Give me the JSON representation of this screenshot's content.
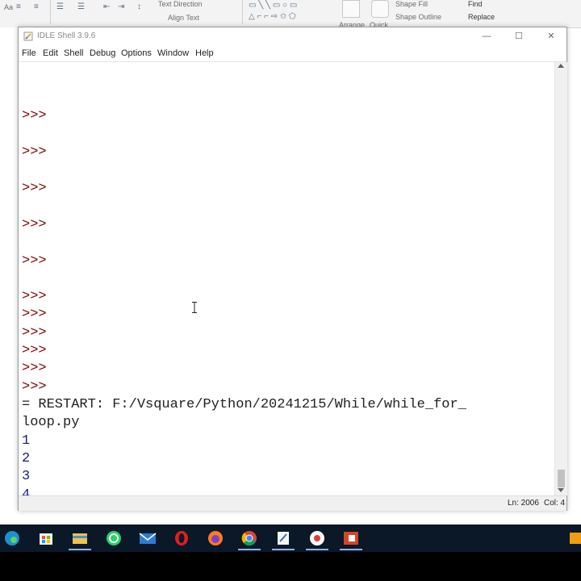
{
  "ribbon": {
    "text_direction": "Text Direction",
    "align_text": "Align Text",
    "shape_fill": "Shape Fill",
    "shape_outline": "Shape Outline",
    "find": "Find",
    "replace": "Replace",
    "arrange": "Arrange",
    "quick": "Quick",
    "font_label": "Aa"
  },
  "window": {
    "title": "IDLE Shell 3.9.6",
    "minimize": "—",
    "maximize": "☐",
    "close": "✕"
  },
  "menu": {
    "file": "File",
    "edit": "Edit",
    "shell": "Shell",
    "debug": "Debug",
    "options": "Options",
    "window": "Window",
    "help": "Help"
  },
  "shell": {
    "prompts": [
      ">>>",
      ">>>",
      ">>>",
      ">>>",
      ">>>",
      ">>>",
      ">>>",
      ">>>",
      ">>>",
      ">>>",
      ">>>"
    ],
    "restart_line1": "= RESTART: F:/Vsquare/Python/20241215/While/while_for_",
    "restart_line2": "loop.py",
    "output": [
      "1",
      "2",
      "3",
      "4"
    ],
    "final_prompt": ">>>"
  },
  "status": {
    "line": "Ln: 2006",
    "col": "Col: 4"
  },
  "taskbar": {
    "apps": [
      "edge-icon",
      "store-icon",
      "file-explorer-icon",
      "whatsapp-icon",
      "mail-icon",
      "opera-icon",
      "firefox-icon",
      "chrome-icon",
      "idle-icon",
      "screen-recorder-icon",
      "powerpoint-icon"
    ]
  },
  "colors": {
    "prompt": "#7f0000",
    "output": "#1a1a8c",
    "taskbar": "#0a1828"
  }
}
